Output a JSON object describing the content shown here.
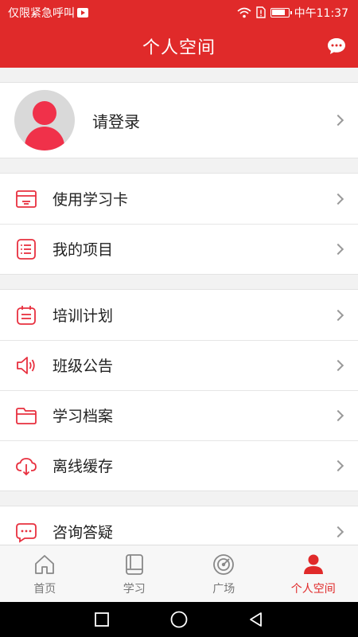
{
  "status_bar": {
    "carrier": "仅限紧急呼叫",
    "time": "中午11:37"
  },
  "header": {
    "title": "个人空间",
    "icon": "chat-bubble-icon"
  },
  "profile": {
    "login_label": "请登录"
  },
  "menu_group_1": [
    {
      "label": "使用学习卡",
      "icon": "study-card-icon"
    },
    {
      "label": "我的项目",
      "icon": "project-list-icon"
    }
  ],
  "menu_group_2": [
    {
      "label": "培训计划",
      "icon": "calendar-icon"
    },
    {
      "label": "班级公告",
      "icon": "speaker-icon"
    },
    {
      "label": "学习档案",
      "icon": "folder-icon"
    },
    {
      "label": "离线缓存",
      "icon": "cloud-download-icon"
    }
  ],
  "menu_group_3": [
    {
      "label": "咨询答疑",
      "icon": "consult-chat-icon"
    }
  ],
  "tabs": [
    {
      "label": "首页",
      "icon": "home-icon",
      "active": false
    },
    {
      "label": "学习",
      "icon": "book-icon",
      "active": false
    },
    {
      "label": "广场",
      "icon": "radar-icon",
      "active": false
    },
    {
      "label": "个人空间",
      "icon": "person-icon",
      "active": true
    }
  ],
  "colors": {
    "accent": "#e02a2a",
    "icon_red": "#e8303f"
  }
}
